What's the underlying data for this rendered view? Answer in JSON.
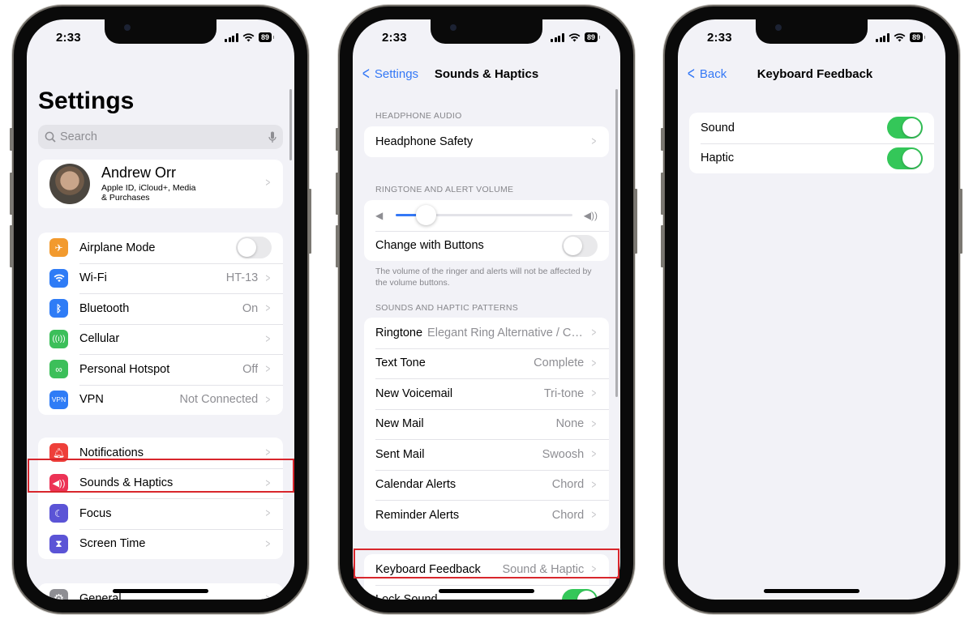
{
  "status_bar": {
    "time": "2:33",
    "battery": "89"
  },
  "phone1": {
    "title": "Settings",
    "search": {
      "placeholder": "Search"
    },
    "profile": {
      "name": "Andrew Orr",
      "subtitle_line1": "Apple ID, iCloud+, Media",
      "subtitle_line2": "& Purchases"
    },
    "group1": [
      {
        "label": "Airplane Mode",
        "icon": "airplane-icon",
        "color": "#f29a2e",
        "toggle": false
      },
      {
        "label": "Wi-Fi",
        "value": "HT-13",
        "icon": "wifi-icon",
        "color": "#2f7cf6"
      },
      {
        "label": "Bluetooth",
        "value": "On",
        "icon": "bluetooth-icon",
        "color": "#2f7cf6"
      },
      {
        "label": "Cellular",
        "value": "",
        "icon": "cellular-icon",
        "color": "#3cbf5a"
      },
      {
        "label": "Personal Hotspot",
        "value": "Off",
        "icon": "hotspot-icon",
        "color": "#3cbf5a"
      },
      {
        "label": "VPN",
        "value": "Not Connected",
        "icon": "vpn-icon",
        "icon_text": "VPN",
        "color": "#2f7cf6"
      }
    ],
    "group2": [
      {
        "label": "Notifications",
        "icon": "notifications-icon",
        "color": "#ee3f3a"
      },
      {
        "label": "Sounds & Haptics",
        "icon": "sounds-icon",
        "color": "#ec3356",
        "highlighted": true
      },
      {
        "label": "Focus",
        "icon": "focus-moon-icon",
        "color": "#5b54d6"
      },
      {
        "label": "Screen Time",
        "icon": "screen-time-icon",
        "color": "#5b54d6"
      }
    ],
    "group3": [
      {
        "label": "General",
        "icon": "gear-icon",
        "color": "#8e8e93"
      }
    ]
  },
  "phone2": {
    "back_label": "Settings",
    "title": "Sounds & Haptics",
    "headphone_header": "HEADPHONE AUDIO",
    "headphone_safety": "Headphone Safety",
    "volume_header": "RINGTONE AND ALERT VOLUME",
    "volume_level": 0.17,
    "change_with_buttons": {
      "label": "Change with Buttons",
      "on": false
    },
    "volume_footnote": "The volume of the ringer and alerts will not be affected by the volume buttons.",
    "patterns_header": "SOUNDS AND HAPTIC PATTERNS",
    "patterns": [
      {
        "label": "Ringtone",
        "value": "Elegant Ring Alternative / Cle..."
      },
      {
        "label": "Text Tone",
        "value": "Complete"
      },
      {
        "label": "New Voicemail",
        "value": "Tri-tone"
      },
      {
        "label": "New Mail",
        "value": "None"
      },
      {
        "label": "Sent Mail",
        "value": "Swoosh"
      },
      {
        "label": "Calendar Alerts",
        "value": "Chord"
      },
      {
        "label": "Reminder Alerts",
        "value": "Chord"
      }
    ],
    "keyboard_feedback": {
      "label": "Keyboard Feedback",
      "value": "Sound & Haptic"
    },
    "lock_sound": {
      "label": "Lock Sound",
      "on": true
    }
  },
  "phone3": {
    "back_label": "Back",
    "title": "Keyboard Feedback",
    "rows": [
      {
        "label": "Sound",
        "on": true
      },
      {
        "label": "Haptic",
        "on": true
      }
    ]
  },
  "colors": {
    "accent": "#3478f6",
    "toggle_on": "#34c759",
    "highlight": "#d8262c",
    "background": "#f2f2f7"
  }
}
